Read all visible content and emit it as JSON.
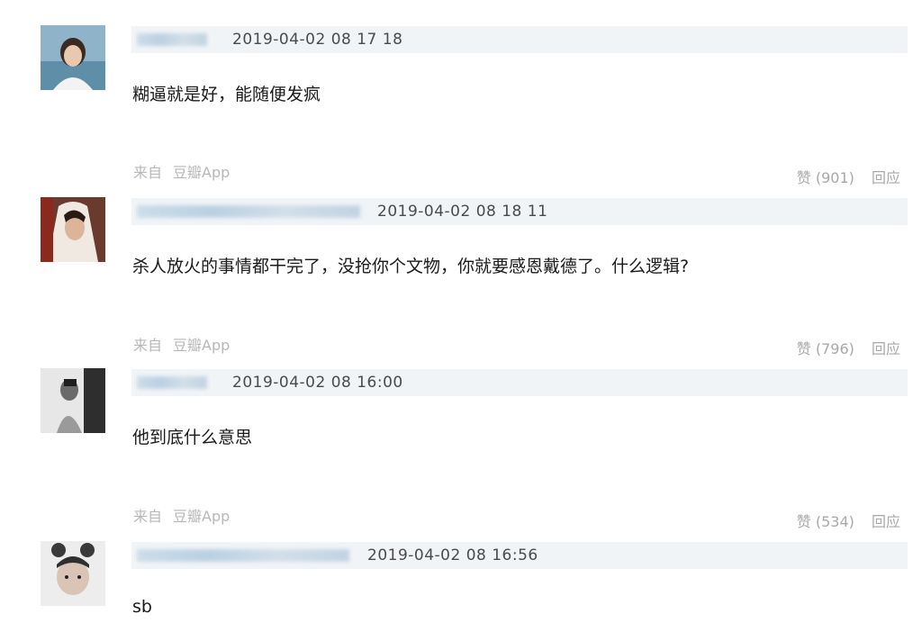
{
  "comments": [
    {
      "timestamp": "2019-04-02 08 17 18",
      "text": "糊逼就是好，能随便发疯",
      "source_label": "来自",
      "source_app": "豆瓣App",
      "like_label": "赞",
      "like_count": "(901)",
      "reply_label": "回应"
    },
    {
      "timestamp": "2019-04-02 08 18 11",
      "text": "杀人放火的事情都干完了，没抢你个文物，你就要感恩戴德了。什么逻辑?",
      "source_label": "来自",
      "source_app": "豆瓣App",
      "like_label": "赞",
      "like_count": "(796)",
      "reply_label": "回应"
    },
    {
      "timestamp": "2019-04-02 08 16:00",
      "text": "他到底什么意思",
      "source_label": "来自",
      "source_app": "豆瓣App",
      "like_label": "赞",
      "like_count": "(534)",
      "reply_label": "回应"
    },
    {
      "timestamp": "2019-04-02 08 16:56",
      "text": "sb"
    }
  ],
  "icons": {
    "avatar_1": "avatar-photo",
    "avatar_2": "avatar-photo",
    "avatar_3": "avatar-photo",
    "avatar_4": "avatar-photo"
  },
  "colors": {
    "meta_bar_bg": "#f1f4f7",
    "muted_text": "#b7b7b7",
    "blurred_name": "#b5cde0"
  }
}
